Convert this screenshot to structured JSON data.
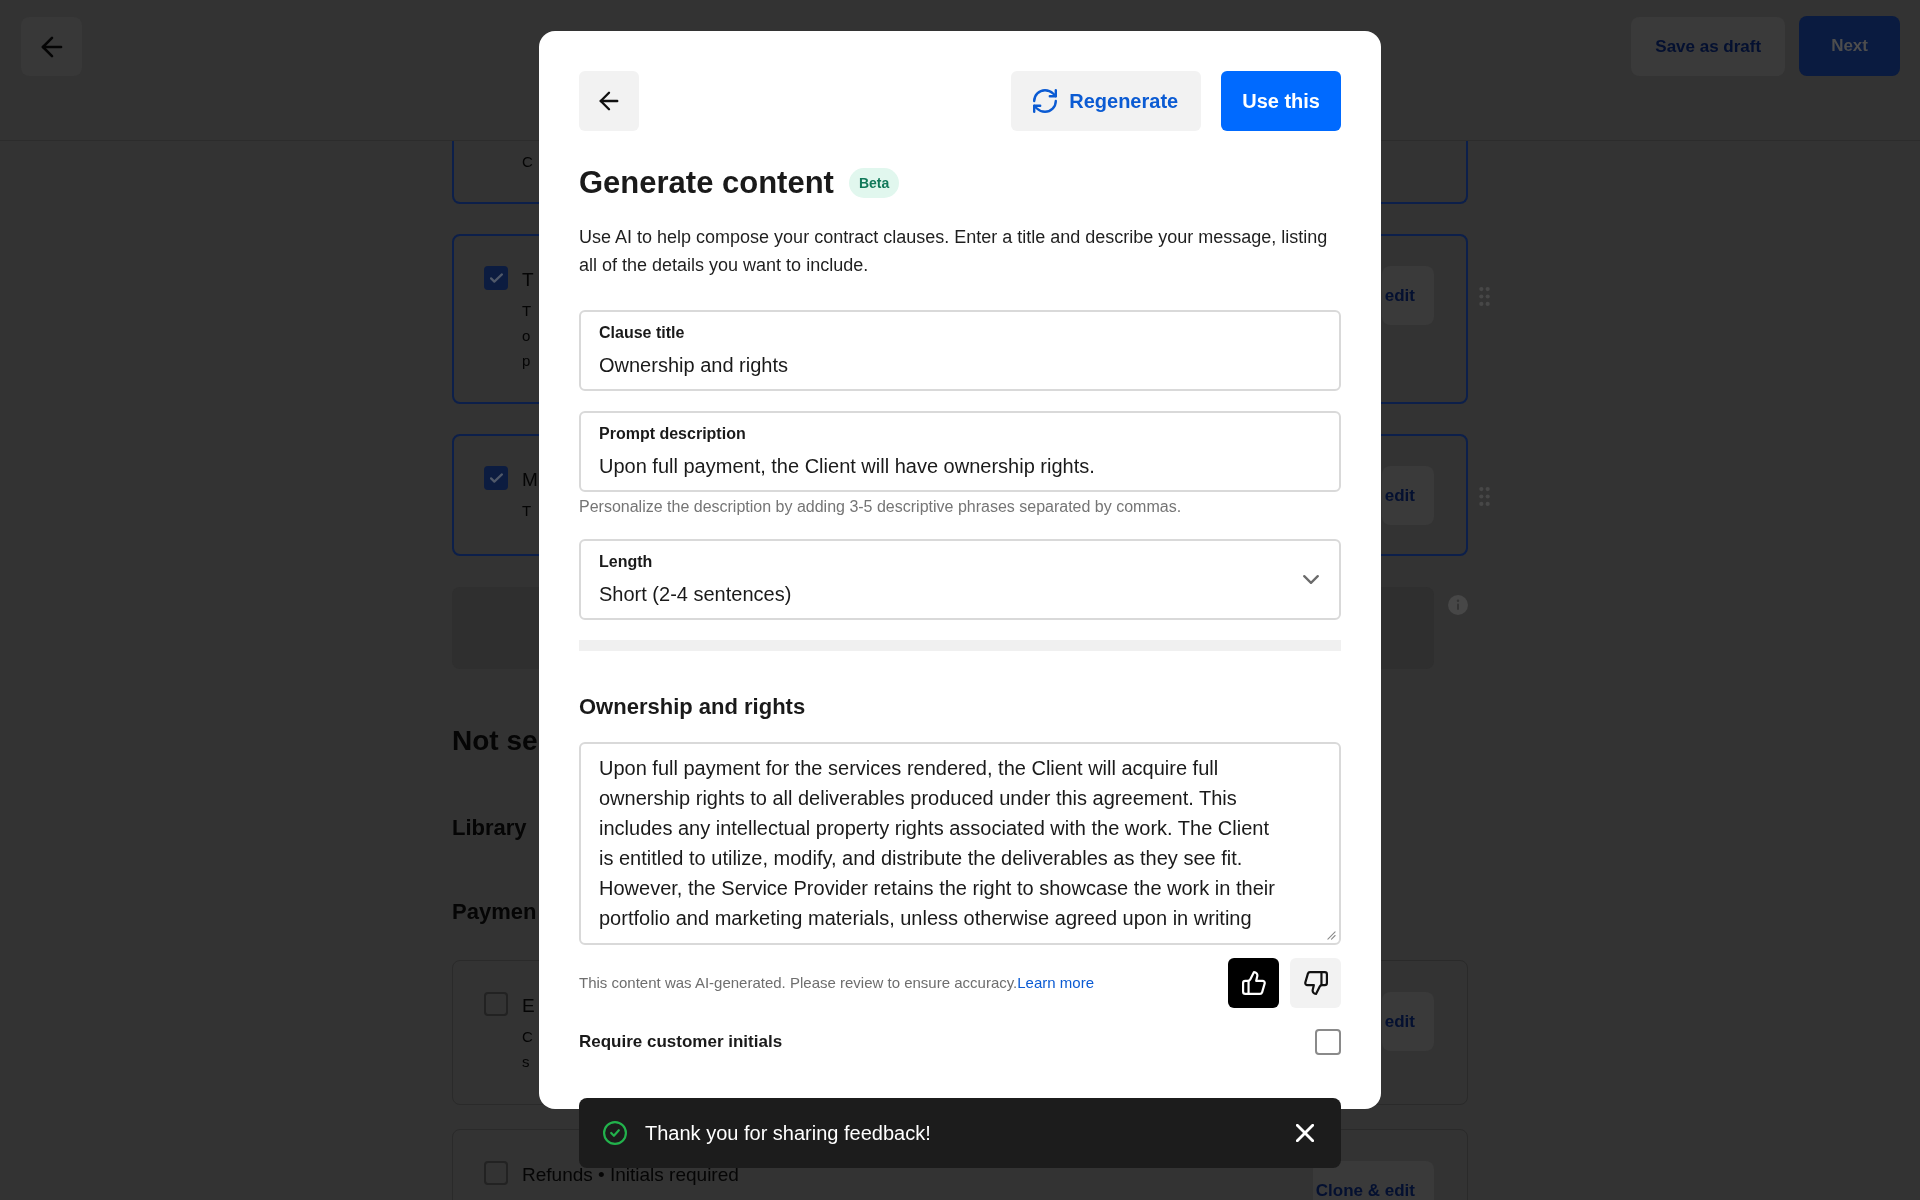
{
  "page_header": {
    "buttons": [
      {
        "label": "Save as draft",
        "kind": "secondary"
      },
      {
        "label": "Next",
        "kind": "primary"
      }
    ]
  },
  "selected_clauses": {
    "scrolled_card": {
      "selected": true,
      "lines": [
        "C"
      ]
    },
    "cards": [
      {
        "checked": true,
        "title": "T",
        "lines": [
          "T",
          "o",
          "p"
        ],
        "action": "edit"
      },
      {
        "checked": true,
        "title": "M",
        "lines": [
          "T"
        ],
        "action": "edit"
      }
    ]
  },
  "not_selected": {
    "heading": "Not se",
    "groups": [
      {
        "heading": "Library"
      },
      {
        "heading": "Paymen",
        "cards": [
          {
            "checked": false,
            "title": "E",
            "lines": [
              "C",
              "s"
            ],
            "action": "edit"
          },
          {
            "checked": false,
            "title": "Refunds • Initials required",
            "action": "Clone & edit"
          }
        ]
      }
    ]
  },
  "modal": {
    "actions": [
      {
        "label": "Regenerate",
        "kind": "secondary"
      },
      {
        "label": "Use this",
        "kind": "primary"
      }
    ],
    "title": "Generate content",
    "badge": "Beta",
    "description": "Use AI to help compose your contract clauses. Enter a title and describe your message, listing all of the details you want to include.",
    "fields": [
      {
        "kind": "text",
        "label": "Clause title",
        "value": "Ownership and rights"
      },
      {
        "kind": "text",
        "label": "Prompt description",
        "value": "Upon full payment, the Client will have ownership rights.",
        "helper": "Personalize the description by adding 3-5 descriptive phrases separated by commas."
      },
      {
        "kind": "select",
        "label": "Length",
        "value": "Short (2-4 sentences)"
      }
    ],
    "result": {
      "heading": "Ownership and rights",
      "text": "Upon full payment for the services rendered, the Client will acquire full ownership rights to all deliverables produced under this agreement. This includes any intellectual property rights associated with the work. The Client is entitled to utilize, modify, and distribute the deliverables as they see fit. However, the Service Provider retains the right to showcase the work in their portfolio and marketing materials, unless otherwise agreed upon in writing"
    },
    "notice": {
      "text": "This content was AI-generated. Please review to ensure accuracy.",
      "link": "Learn more"
    },
    "feedback": [
      {
        "kind": "thumbs_up",
        "selected": true
      },
      {
        "kind": "thumbs_down",
        "selected": false
      }
    ],
    "require_initials": {
      "label": "Require customer initials",
      "checked": false
    }
  },
  "toast": {
    "message": "Thank you for sharing feedback!"
  }
}
